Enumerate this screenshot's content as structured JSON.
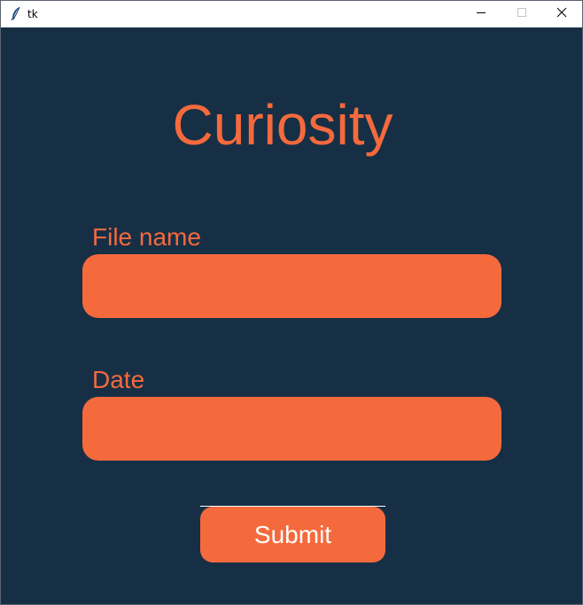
{
  "window": {
    "title": "tk",
    "controls": [
      "minimize",
      "maximize",
      "close"
    ]
  },
  "app": {
    "heading": "Curiosity",
    "file_name": {
      "label": "File name",
      "value": "",
      "placeholder": ""
    },
    "date": {
      "label": "Date",
      "value": "",
      "placeholder": ""
    },
    "submit_label": "Submit"
  },
  "colors": {
    "background": "#172f45",
    "accent": "#f56a3d",
    "button_text": "#ffffff"
  },
  "icons": {
    "app": "feather-icon",
    "minimize": "minimize-icon",
    "maximize": "maximize-icon",
    "close": "close-icon"
  }
}
